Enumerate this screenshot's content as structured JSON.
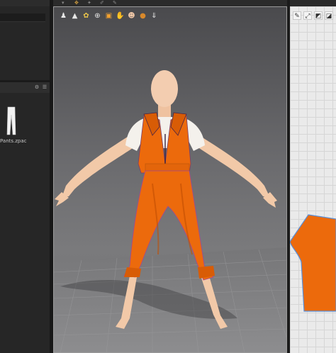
{
  "library": {
    "file_label": "Pants.zpac",
    "header_icons": [
      "gear-icon",
      "list-icon"
    ]
  },
  "toolbar": {
    "icons": [
      "arrow-icon",
      "move-icon",
      "pin-icon",
      "brush-icon",
      "pen-icon"
    ]
  },
  "viewport": {
    "display_icons": [
      {
        "name": "avatar-display-icon",
        "glyph": "♟"
      },
      {
        "name": "garment-display-icon",
        "glyph": "👕"
      },
      {
        "name": "texture-display-icon",
        "glyph": "✿"
      },
      {
        "name": "pin-display-icon",
        "glyph": "⊕"
      },
      {
        "name": "fabric-display-icon",
        "glyph": "▣"
      },
      {
        "name": "arrangement-display-icon",
        "glyph": "✋"
      },
      {
        "name": "skin-display-icon",
        "glyph": "☻"
      },
      {
        "name": "material-display-icon",
        "glyph": "●"
      },
      {
        "name": "measure-display-icon",
        "glyph": "⇓"
      }
    ],
    "colors": {
      "garment": "#ec6a0c",
      "garment_shade": "#c24f04",
      "skin": "#f2c9a8",
      "shirt": "#f4f1ec",
      "floor_grid": "#8a8a8c"
    }
  },
  "pattern_panel": {
    "icons": [
      {
        "name": "select-pattern-icon",
        "glyph": "✎"
      },
      {
        "name": "transform-pattern-icon",
        "glyph": "⤢"
      },
      {
        "name": "edit-point-icon",
        "glyph": "◩"
      },
      {
        "name": "add-point-icon",
        "glyph": "◪"
      }
    ],
    "pattern_color": "#ec6a0c"
  }
}
